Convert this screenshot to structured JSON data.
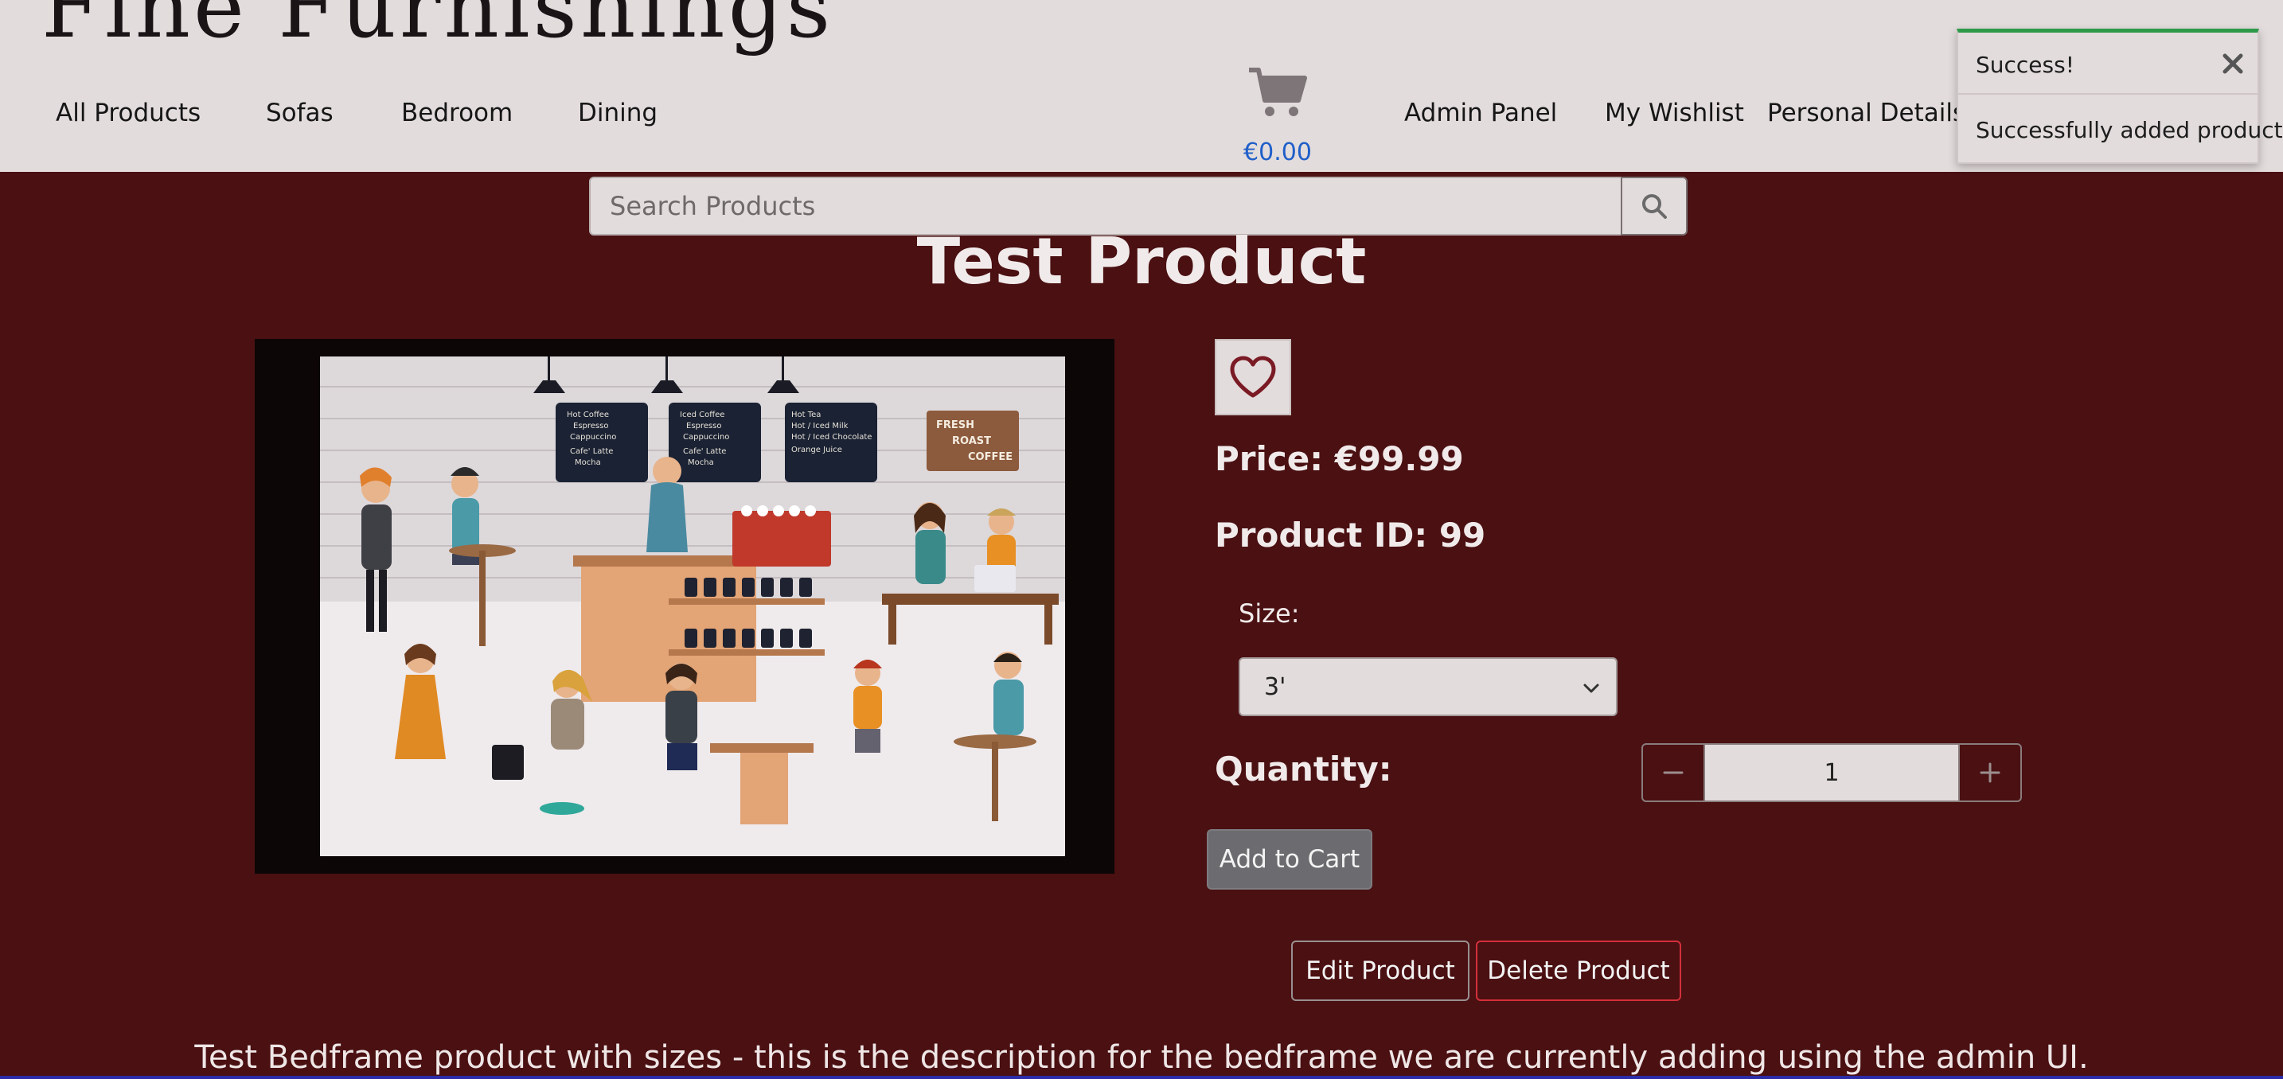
{
  "header": {
    "brand": "Fine Furnishings",
    "nav_left": [
      "All Products",
      "Sofas",
      "Bedroom",
      "Dining"
    ],
    "nav_right": [
      "Admin Panel",
      "My Wishlist",
      "Personal Details"
    ],
    "cart_icon": "shopping-cart-icon",
    "cart_total": "€0.00"
  },
  "toast": {
    "title": "Success!",
    "message": "Successfully added product!",
    "close_icon": "close-icon",
    "status_color": "#2e9a4a"
  },
  "search": {
    "placeholder": "Search Products",
    "icon": "search-icon"
  },
  "product": {
    "title": "Test Product",
    "wishlist_icon": "heart-icon",
    "price": "Price: €99.99",
    "product_id": "Product ID: 99",
    "size_label": "Size:",
    "size_selected": "3'",
    "quantity_label": "Quantity:",
    "quantity_value": "1",
    "add_to_cart": "Add to Cart",
    "edit": "Edit Product",
    "delete": "Delete Product",
    "description": "Test Bedframe product with sizes - this is the description for the bedframe we are currently adding using the admin UI."
  },
  "image": {
    "menu_boards": [
      [
        "Hot Coffee",
        "Espresso",
        "Cappuccino",
        "Cafe' Latte",
        "Mocha"
      ],
      [
        "Iced Coffee",
        "Espresso",
        "Cappuccino",
        "Cafe' Latte",
        "Mocha"
      ],
      [
        "Hot Tea",
        "Hot / Iced Milk",
        "Hot / Iced Chocolate",
        "Orange Juice"
      ]
    ],
    "sign": [
      "FRESH",
      "ROAST",
      "COFFEE"
    ]
  },
  "colors": {
    "page_bg": "#4a1012",
    "header_bg": "#e3dcdc",
    "link": "#1f5fc9",
    "danger": "#d42f3b"
  }
}
